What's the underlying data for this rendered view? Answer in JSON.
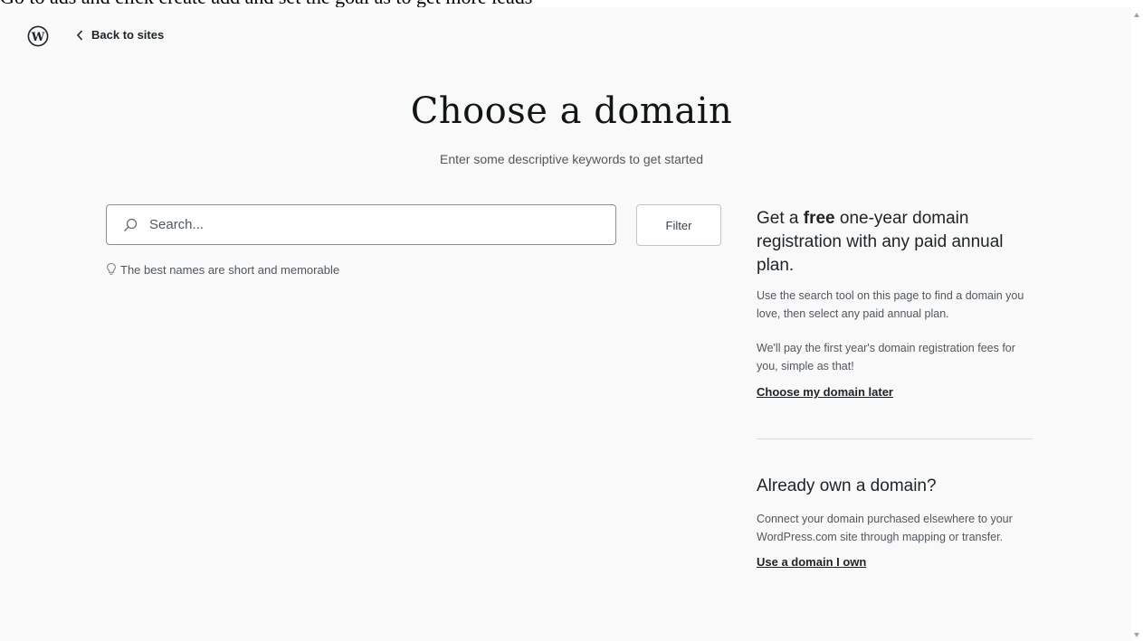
{
  "instruction": "Go to ads and click create add and set the goal as to get more leads",
  "header": {
    "logo_icon": "wordpress-logo-icon",
    "back_label": "Back to sites"
  },
  "main": {
    "title": "Choose a domain",
    "subtitle": "Enter some descriptive keywords to get started",
    "search": {
      "placeholder": "Search...",
      "value": ""
    },
    "filter_label": "Filter",
    "tip": "The best names are short and memorable"
  },
  "promo": {
    "heading_pre": "Get a ",
    "heading_bold": "free",
    "heading_post": " one-year domain registration with any paid annual plan.",
    "paragraph1": "Use the search tool on this page to find a domain you love, then select any paid annual plan.",
    "paragraph2": "We'll pay the first year's domain registration fees for you, simple as that!",
    "link": "Choose my domain later"
  },
  "own_domain": {
    "heading": "Already own a domain?",
    "paragraph": "Connect your domain purchased elsewhere to your WordPress.com site through mapping or transfer.",
    "link": "Use a domain I own"
  },
  "colors": {
    "page_bg": "#f9f9f9",
    "text": "#1d2327",
    "muted": "#50575e",
    "border": "#8c8f94"
  }
}
